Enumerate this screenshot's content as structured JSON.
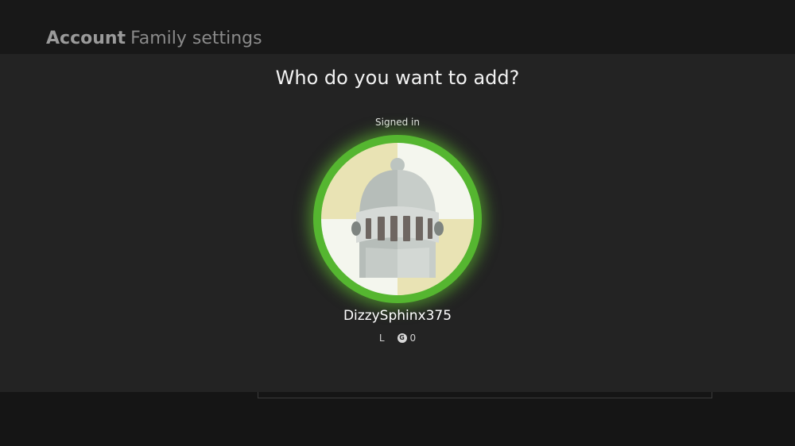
{
  "header": {
    "section": "Account",
    "page": "Family settings"
  },
  "dialog": {
    "title": "Who do you want to add?"
  },
  "profile": {
    "status": "Signed in",
    "gamertag": "DizzySphinx375",
    "level_label": "L",
    "gamerscore_icon": "G",
    "gamerscore": "0",
    "avatar_icon": "knight-helmet-icon",
    "ring_color": "#55b630"
  }
}
